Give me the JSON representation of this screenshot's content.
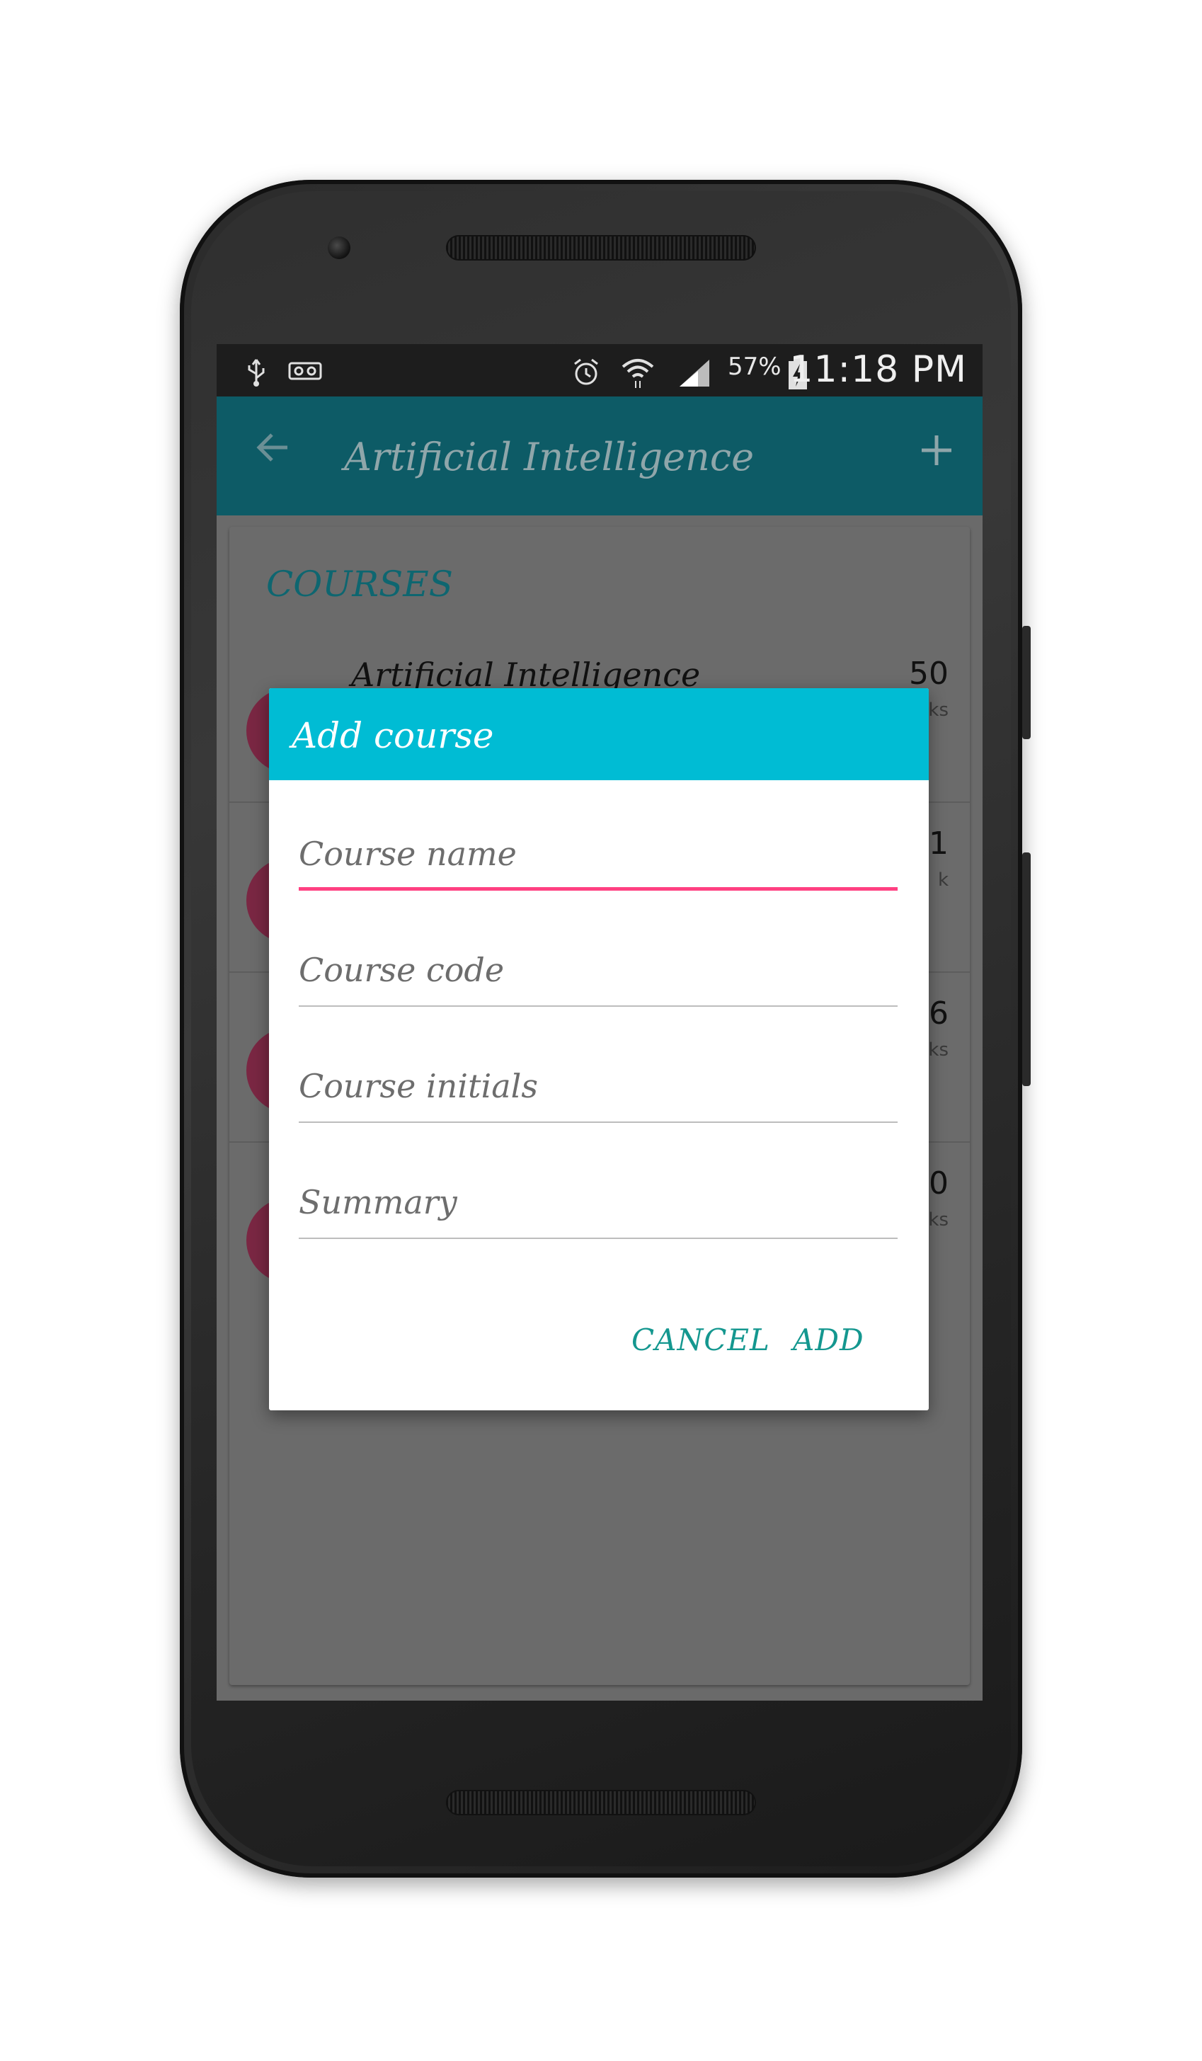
{
  "status_bar": {
    "battery": "57%",
    "time": "11:18 PM",
    "icons": [
      "usb-icon",
      "voicemail-icon",
      "alarm-icon",
      "wifi-icon",
      "signal-icon",
      "battery-charging-icon"
    ]
  },
  "toolbar": {
    "title": "Artificial Intelligence",
    "back_icon": "arrow-left-icon",
    "add_icon": "plus-icon"
  },
  "courses": {
    "header": "COURSES",
    "items": [
      {
        "title": "Artificial Intelligence",
        "count": "50",
        "unit": "ks"
      },
      {
        "title": "",
        "count": "1",
        "unit": "k"
      },
      {
        "title": "",
        "count": "6",
        "unit": "ks"
      },
      {
        "title": "",
        "count": "0",
        "unit": "ks"
      }
    ]
  },
  "dialog": {
    "title": "Add course",
    "fields": {
      "course_name": {
        "value": "",
        "placeholder": "Course name"
      },
      "course_code": {
        "value": "",
        "placeholder": "Course code"
      },
      "course_initials": {
        "value": "",
        "placeholder": "Course initials"
      },
      "summary": {
        "value": "",
        "placeholder": "Summary"
      }
    },
    "cancel_label": "CANCEL",
    "add_label": "ADD"
  },
  "colors": {
    "toolbar": "#0d5b66",
    "dialog_header": "#00bcd4",
    "accent": "#ff4081",
    "button_text": "#14978f",
    "avatar": "#7a2743"
  }
}
